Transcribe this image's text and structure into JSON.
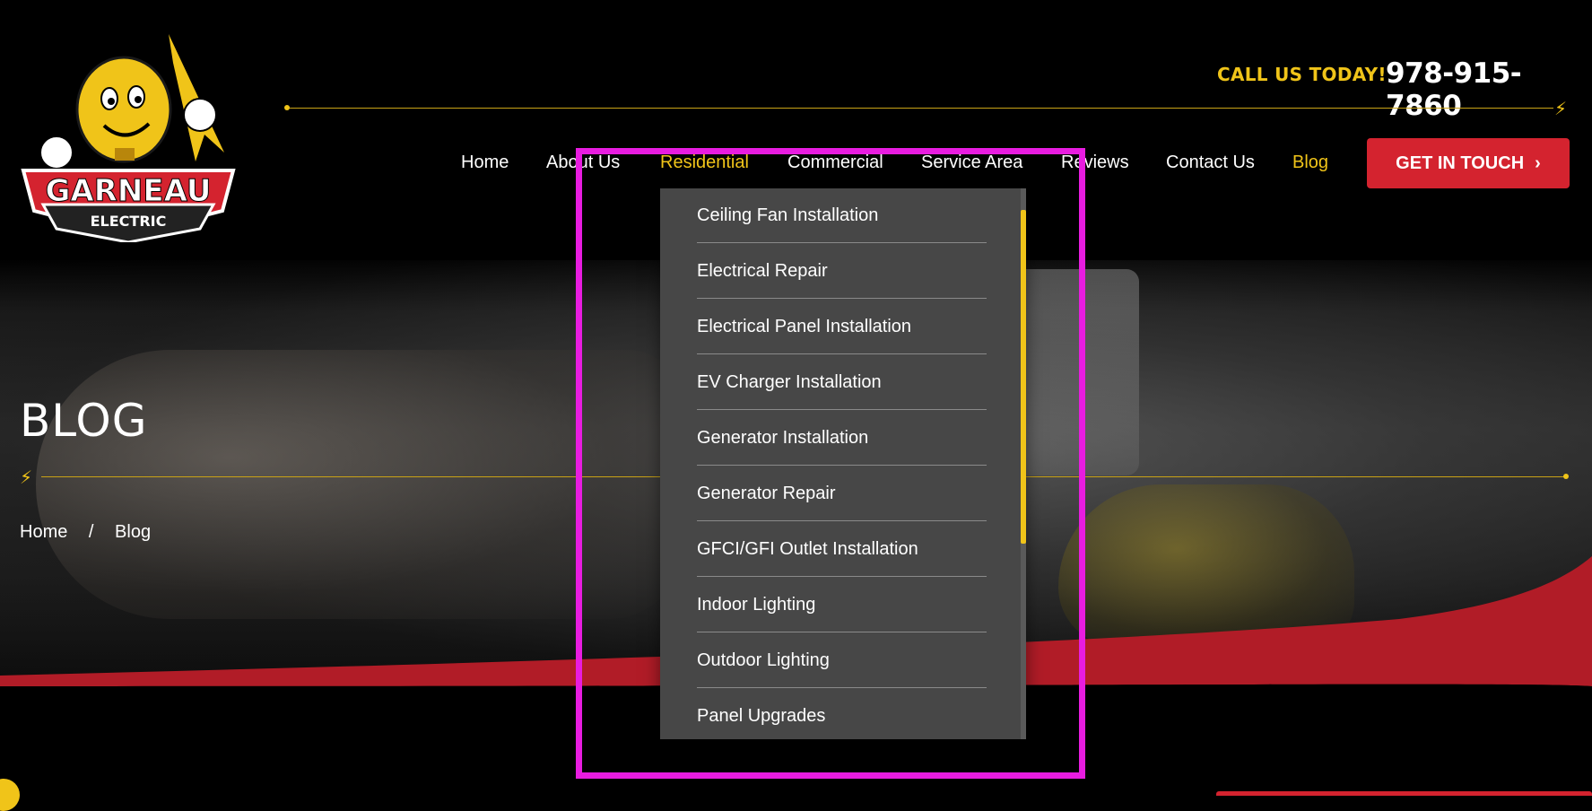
{
  "brand": {
    "name_line1": "GARNEAU",
    "name_line2": "ELECTRIC",
    "colors": {
      "yellow": "#f0c419",
      "red": "#d4232f",
      "black": "#000000"
    }
  },
  "header": {
    "call_label": "CALL US TODAY!",
    "phone": "978-915-7860",
    "cta_label": "GET IN TOUCH",
    "cta_icon": "chevron-right-icon"
  },
  "nav": {
    "items": [
      {
        "label": "Home"
      },
      {
        "label": "About Us"
      },
      {
        "label": "Residential",
        "state": "hover"
      },
      {
        "label": "Commercial"
      },
      {
        "label": "Service Area"
      },
      {
        "label": "Reviews"
      },
      {
        "label": "Contact Us"
      },
      {
        "label": "Blog",
        "state": "current"
      }
    ]
  },
  "dropdown": {
    "items": [
      "Ceiling Fan Installation",
      "Electrical Repair",
      "Electrical Panel Installation",
      "EV Charger Installation",
      "Generator Installation",
      "Generator Repair",
      "GFCI/GFI Outlet Installation",
      "Indoor Lighting",
      "Outdoor Lighting",
      "Panel Upgrades"
    ]
  },
  "page": {
    "title": "BLOG",
    "breadcrumb": [
      "Home",
      "/",
      "Blog"
    ]
  }
}
